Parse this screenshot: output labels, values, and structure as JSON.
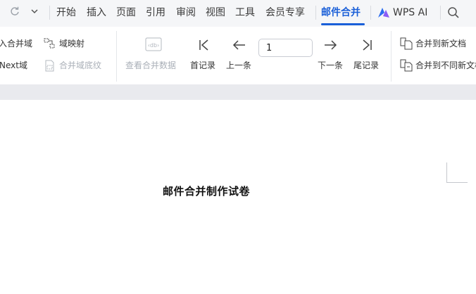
{
  "menu": {
    "tabs": [
      "开始",
      "插入",
      "页面",
      "引用",
      "审阅",
      "视图",
      "工具",
      "会员专享",
      "邮件合并"
    ],
    "active_tab": "邮件合并",
    "wps_ai": "WPS AI"
  },
  "ribbon": {
    "insert_field": "入合并域",
    "field_mapping": "域映射",
    "next_field": "Next域",
    "field_shading": "合并域底纹",
    "view_merged_data": "查看合并数据",
    "first_record": "首记录",
    "prev_record": "上一条",
    "record_number": "1",
    "next_record": "下一条",
    "last_record": "尾记录",
    "merge_to_new_doc": "合并到新文档",
    "merge_to_different_doc": "合并到不同新文档"
  },
  "document": {
    "title": "邮件合并制作试卷"
  },
  "colors": {
    "accent": "#1a5fd8",
    "menubar_bg": "#f5f6f8"
  }
}
